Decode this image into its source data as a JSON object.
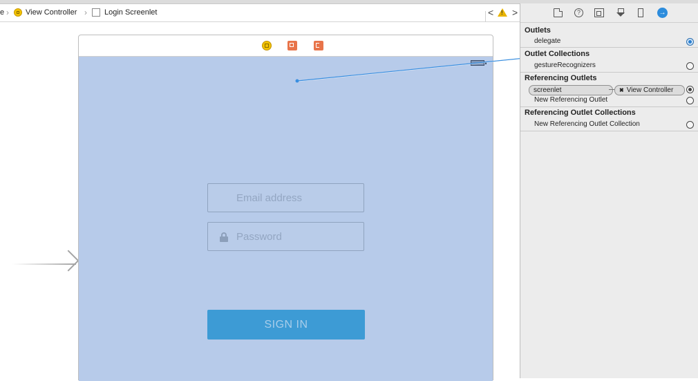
{
  "breadcrumb": {
    "partial_item": "e",
    "view_controller": "View Controller",
    "login_screenlet": "Login Screenlet"
  },
  "toolbar": {
    "back_glyph": "<",
    "forward_glyph": ">",
    "warning_glyph": "!"
  },
  "scene": {
    "email_placeholder": "Email address",
    "password_placeholder": "Password",
    "signin_label": "SIGN IN",
    "screenlet_color": "#b7cbea",
    "button_color": "#3d9bd5"
  },
  "inspector": {
    "help_glyph": "?",
    "connections_glyph": "→",
    "outlets": {
      "title": "Outlets",
      "items": [
        {
          "label": "delegate",
          "connected": true
        }
      ]
    },
    "outlet_collections": {
      "title": "Outlet Collections",
      "items": [
        {
          "label": "gestureRecognizers",
          "connected": false
        }
      ]
    },
    "referencing_outlets": {
      "title": "Referencing Outlets",
      "connection": {
        "source": "screenlet",
        "target": "View Controller",
        "target_mark": "✖"
      },
      "new_item": "New Referencing Outlet"
    },
    "referencing_outlet_collections": {
      "title": "Referencing Outlet Collections",
      "new_item": "New Referencing Outlet Collection"
    }
  },
  "icons": {
    "breadcrumb_vc": "view-controller-icon",
    "breadcrumb_view": "view-icon",
    "scene_vc": "view-controller-icon",
    "scene_first_responder": "first-responder-icon",
    "scene_exit": "exit-icon",
    "lock": "lock-icon",
    "warning": "warning-icon"
  },
  "connector_color": "#3a8fe0"
}
